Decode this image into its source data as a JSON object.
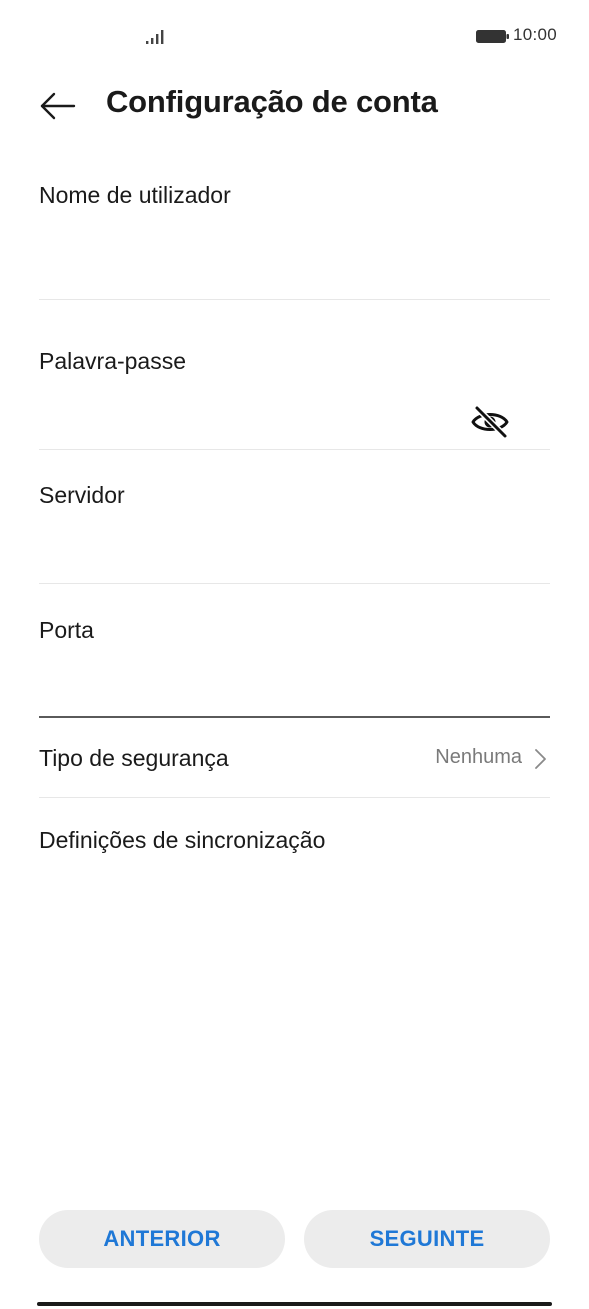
{
  "status_bar": {
    "time": "10:00",
    "signal_icon": "signal-bars-icon",
    "battery_icon": "battery-full-icon"
  },
  "header": {
    "back_icon": "arrow-left-icon",
    "title": "Configuração de conta"
  },
  "form": {
    "username": {
      "label": "Nome de utilizador",
      "value": "",
      "placeholder": ""
    },
    "password": {
      "label": "Palavra-passe",
      "value": "",
      "placeholder": "",
      "visibility_icon": "eye-off-icon"
    },
    "server": {
      "label": "Servidor",
      "value": "",
      "placeholder": ""
    },
    "port": {
      "label": "Porta",
      "value": "",
      "placeholder": ""
    }
  },
  "security": {
    "label": "Tipo de segurança",
    "value": "Nenhuma",
    "chevron_icon": "chevron-right-icon"
  },
  "sync": {
    "label": "Definições de sincronização"
  },
  "actions": {
    "previous_label": "ANTERIOR",
    "next_label": "SEGUINTE"
  },
  "colors": {
    "accent": "#1f78d6",
    "button_bg": "#ececec",
    "divider": "#e7e7e7",
    "secondary_text": "#7a7a7a"
  }
}
